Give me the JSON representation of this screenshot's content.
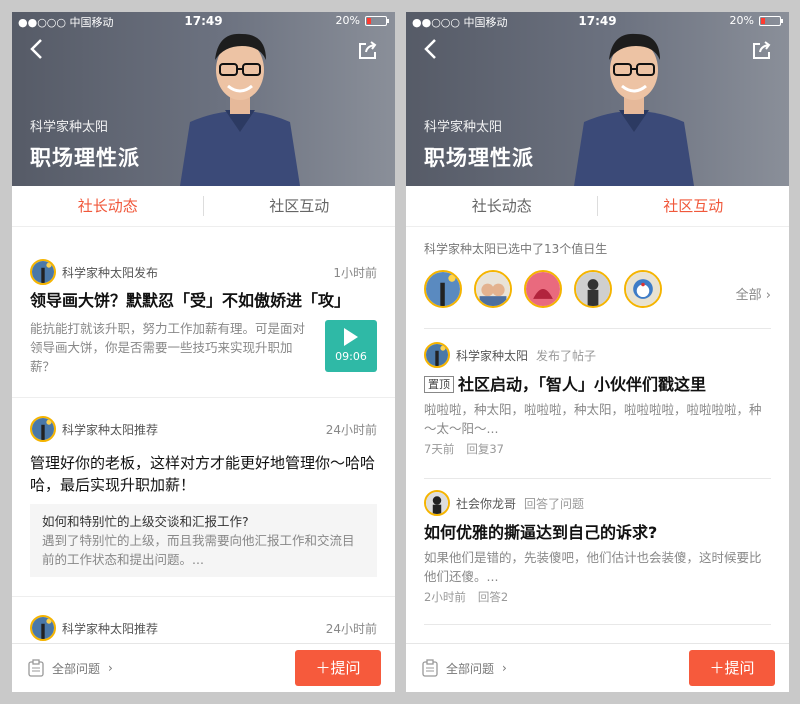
{
  "status": {
    "carrier": "●●○○○ 中国移动",
    "time": "17:49",
    "battery": "20%"
  },
  "hero": {
    "subtitle": "科学家种太阳",
    "title": "职场理性派"
  },
  "tabs": {
    "left": "社长动态",
    "right": "社区互动"
  },
  "left_feed": [
    {
      "author": "科学家种太阳发布",
      "time": "1小时前",
      "title": "领导画大饼？默默忍「受」不如傲娇进「攻」",
      "body": "能抗能打就该升职，努力工作加薪有理。可是面对领导画大饼，你是否需要一些技巧来实现升职加薪？",
      "duration": "09:06"
    },
    {
      "author": "科学家种太阳推荐",
      "time": "24小时前",
      "title": "管理好你的老板，这样对方才能更好地管理你～哈哈哈，最后实现升职加薪！",
      "quote_title": "如何和特别忙的上级交谈和汇报工作?",
      "quote_body": "遇到了特别忙的上级，而且我需要向他汇报工作和交流目前的工作状态和提出问题。..."
    },
    {
      "author": "科学家种太阳推荐",
      "time": "24小时前"
    }
  ],
  "right": {
    "selected_info": "科学家种太阳已选中了13个值日生",
    "all_label": "全部",
    "posts": [
      {
        "author": "科学家种太阳",
        "action": "发布了帖子",
        "tag": "置顶",
        "title": "社区启动，「智人」小伙伴们戳这里",
        "body": "啦啦啦，种太阳，啦啦啦，种太阳，啦啦啦啦，啦啦啦啦，种～太～阳～...",
        "time": "7天前",
        "replies": "回复37"
      },
      {
        "author": "社会你龙哥",
        "action": "回答了问题",
        "title": "如何优雅的撕逼达到自己的诉求?",
        "body": "如果他们是错的，先装傻吧，他们估计也会装傻，这时候要比他们还傻。...",
        "time": "2小时前",
        "replies": "回答2"
      }
    ]
  },
  "bottom": {
    "all_questions": "全部问题",
    "ask": "提问"
  }
}
